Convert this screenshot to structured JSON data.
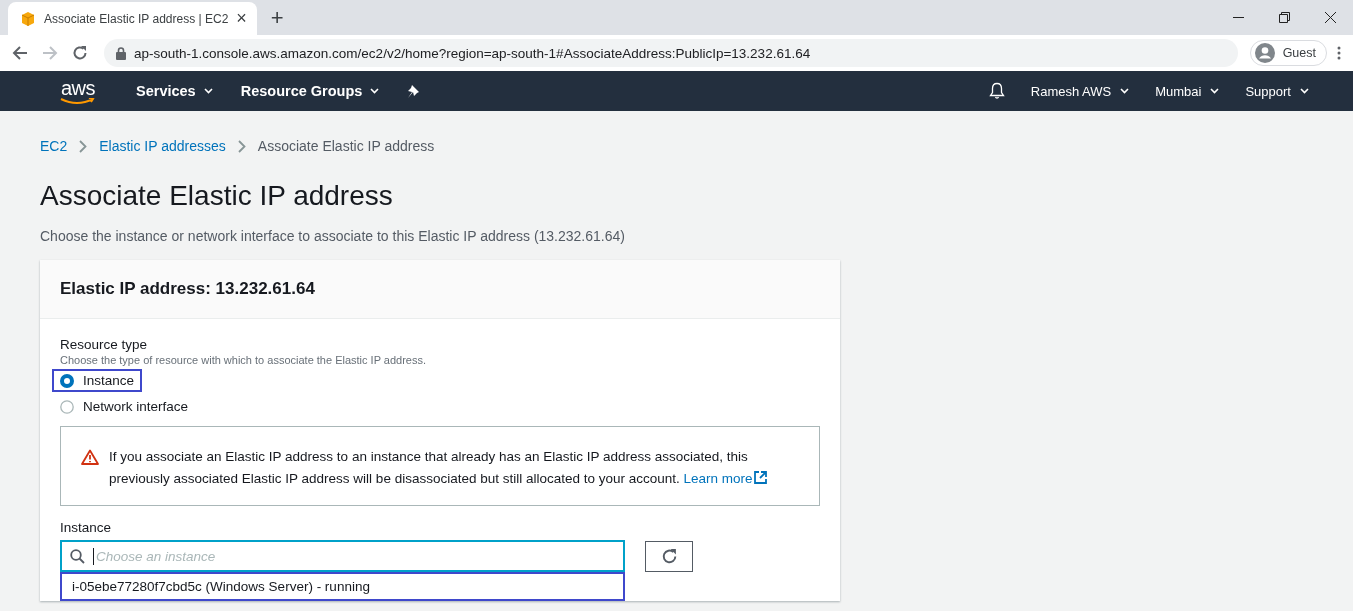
{
  "browser": {
    "tab": {
      "title": "Associate Elastic IP address | EC2",
      "close": "×"
    },
    "new_tab": "+",
    "url": "ap-south-1.console.aws.amazon.com/ec2/v2/home?region=ap-south-1#AssociateAddress:PublicIp=13.232.61.64",
    "forward_disabled": true,
    "profile": "Guest"
  },
  "nav": {
    "logo": "aws",
    "left": [
      {
        "label": "Services",
        "kind": "menu"
      },
      {
        "label": "Resource Groups",
        "kind": "menu"
      },
      {
        "kind": "pin"
      }
    ],
    "right": [
      {
        "kind": "bell"
      },
      {
        "label": "Ramesh AWS",
        "kind": "menu"
      },
      {
        "label": "Mumbai",
        "kind": "menu"
      },
      {
        "label": "Support",
        "kind": "menu"
      }
    ]
  },
  "breadcrumbs": [
    {
      "label": "EC2",
      "link": true
    },
    {
      "label": "Elastic IP addresses",
      "link": true
    },
    {
      "label": "Associate Elastic IP address",
      "link": false
    }
  ],
  "page": {
    "title": "Associate Elastic IP address",
    "description": "Choose the instance or network interface to associate to this Elastic IP address (13.232.61.64)"
  },
  "card": {
    "title": "Elastic IP address: 13.232.61.64",
    "resource_type": {
      "label": "Resource type",
      "description": "Choose the type of resource with which to associate the Elastic IP address.",
      "options": [
        {
          "label": "Instance",
          "selected": true,
          "highlighted": true
        },
        {
          "label": "Network interface",
          "selected": false,
          "highlighted": false
        }
      ]
    },
    "alert": {
      "text": "If you associate an Elastic IP address to an instance that already has an Elastic IP address associated, this previously associated Elastic IP address will be disassociated but still allocated to your account.",
      "link": "Learn more"
    },
    "instance": {
      "label": "Instance",
      "placeholder": "Choose an instance",
      "options": [
        {
          "label": "i-05ebe77280f7cbd5c (Windows Server) - running",
          "highlighted": true
        }
      ]
    }
  }
}
